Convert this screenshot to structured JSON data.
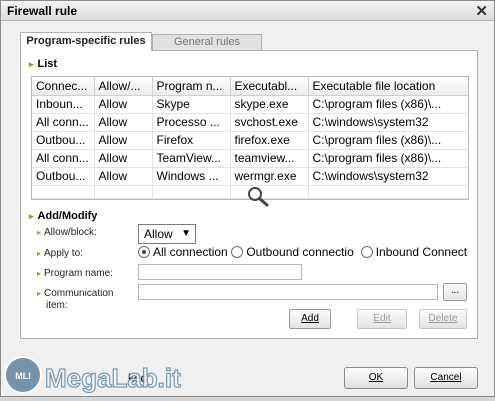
{
  "window": {
    "title": "Firewall rule",
    "close_glyph": "✕"
  },
  "tabs": [
    {
      "label": "Program-specific rules",
      "active": true
    },
    {
      "label": "General rules",
      "active": false
    }
  ],
  "list": {
    "heading": "List",
    "columns": [
      "Connec...",
      "Allow/...",
      "Program n...",
      "Executabl...",
      "Executable file location"
    ],
    "rows": [
      [
        "Inboun...",
        "Allow",
        "Skype",
        "skype.exe",
        "C:\\program files (x86)\\..."
      ],
      [
        "All conn...",
        "Allow",
        "Processo ...",
        "svchost.exe",
        "C:\\windows\\system32"
      ],
      [
        "Outbou...",
        "Allow",
        "Firefox",
        "firefox.exe",
        "C:\\program files (x86)\\..."
      ],
      [
        "All conn...",
        "Allow",
        "TeamView...",
        "teamview...",
        "C:\\program files (x86)\\..."
      ],
      [
        "Outbou...",
        "Allow",
        "Windows ...",
        "wermgr.exe",
        "C:\\windows\\system32"
      ]
    ]
  },
  "add_modify": {
    "heading": "Add/Modify",
    "allow_block_label": "Allow/block:",
    "allow_block_value": "Allow",
    "apply_to_label": "Apply to:",
    "apply_options": [
      "All connection",
      "Outbound connectio",
      "Inbound Connectio"
    ],
    "program_name_label": "Program name:",
    "program_name_value": "",
    "communication_label_1": "Communication",
    "communication_label_2": "item:",
    "communication_value": "",
    "browse_label": "...",
    "add_label": "Add",
    "edit_label": "Edit",
    "delete_label": "Delete"
  },
  "footer": {
    "partial_text": "ked",
    "ok_label": "OK",
    "cancel_label": "Cancel"
  },
  "watermark": {
    "text": "MegaLab.it",
    "badge": "MLI"
  },
  "colors": {
    "accent_bullet": "#c58a00",
    "panel_bg": "#ffffff",
    "window_bg": "#f0f0f0"
  },
  "icons": {
    "magnifier": "magnifier-icon",
    "dropdown": "chevron-down-icon"
  }
}
